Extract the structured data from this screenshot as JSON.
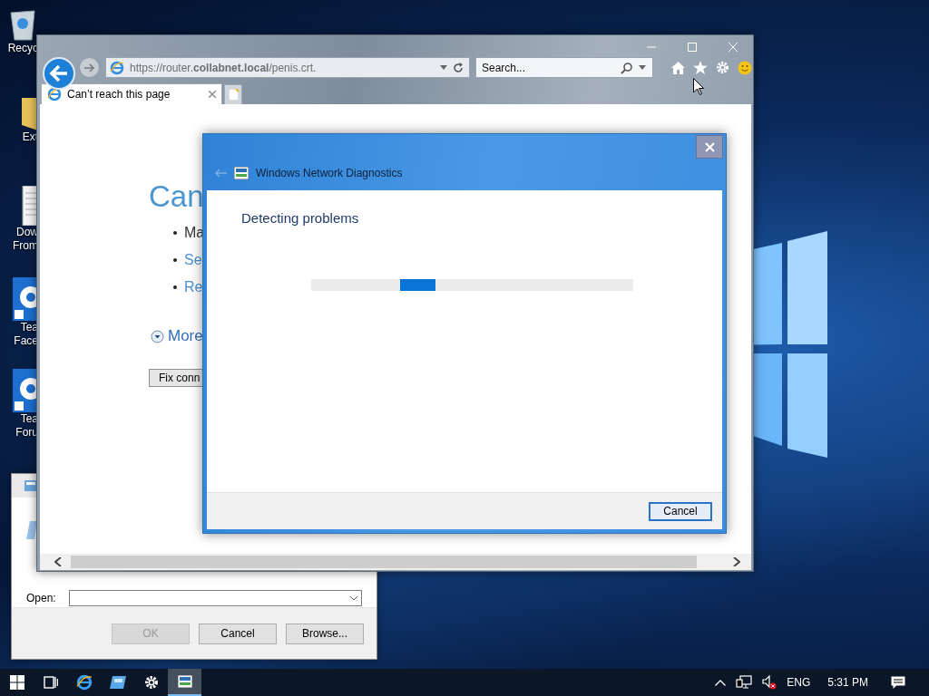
{
  "desktop": {
    "icons": [
      {
        "kind": "recycle",
        "lines": [
          "Recyc"
        ]
      },
      {
        "kind": "folder",
        "lines": [
          "Ext"
        ]
      },
      {
        "kind": "document",
        "lines": [
          "Dow",
          "From"
        ]
      },
      {
        "kind": "gear",
        "lines": [
          "Tea",
          "Face"
        ]
      },
      {
        "kind": "gear",
        "lines": [
          "Tea",
          "Foru"
        ]
      }
    ]
  },
  "run_dialog": {
    "open_label": "Open:",
    "buttons": [
      {
        "label": "OK",
        "disabled": true
      },
      {
        "label": "Cancel",
        "disabled": false
      },
      {
        "label": "Browse...",
        "disabled": false
      }
    ]
  },
  "browser": {
    "address": "https://router.**collabnet.local**/penis.crt.",
    "search": {
      "placeholder": "Search..."
    },
    "tabs": [
      {
        "title": "Can’t reach this page",
        "selected": true
      }
    ],
    "page": {
      "heading": "Can",
      "bullets": [
        {
          "text": "Ma",
          "kind": "text"
        },
        {
          "text": "Se",
          "kind": "link"
        },
        {
          "text": "Re",
          "kind": "link"
        }
      ],
      "more": "More",
      "fix_button": "Fix conn"
    }
  },
  "diagnostics": {
    "title": "Windows Network Diagnostics",
    "heading": "Detecting problems",
    "cancel": "Cancel"
  },
  "taskbar": {
    "apps": [
      {
        "kind": "ie",
        "active": false
      },
      {
        "kind": "window",
        "active": false
      },
      {
        "kind": "gear",
        "active": false
      },
      {
        "kind": "diagnostics",
        "active": true
      }
    ],
    "language": "ENG",
    "time": "5:31 PM"
  }
}
